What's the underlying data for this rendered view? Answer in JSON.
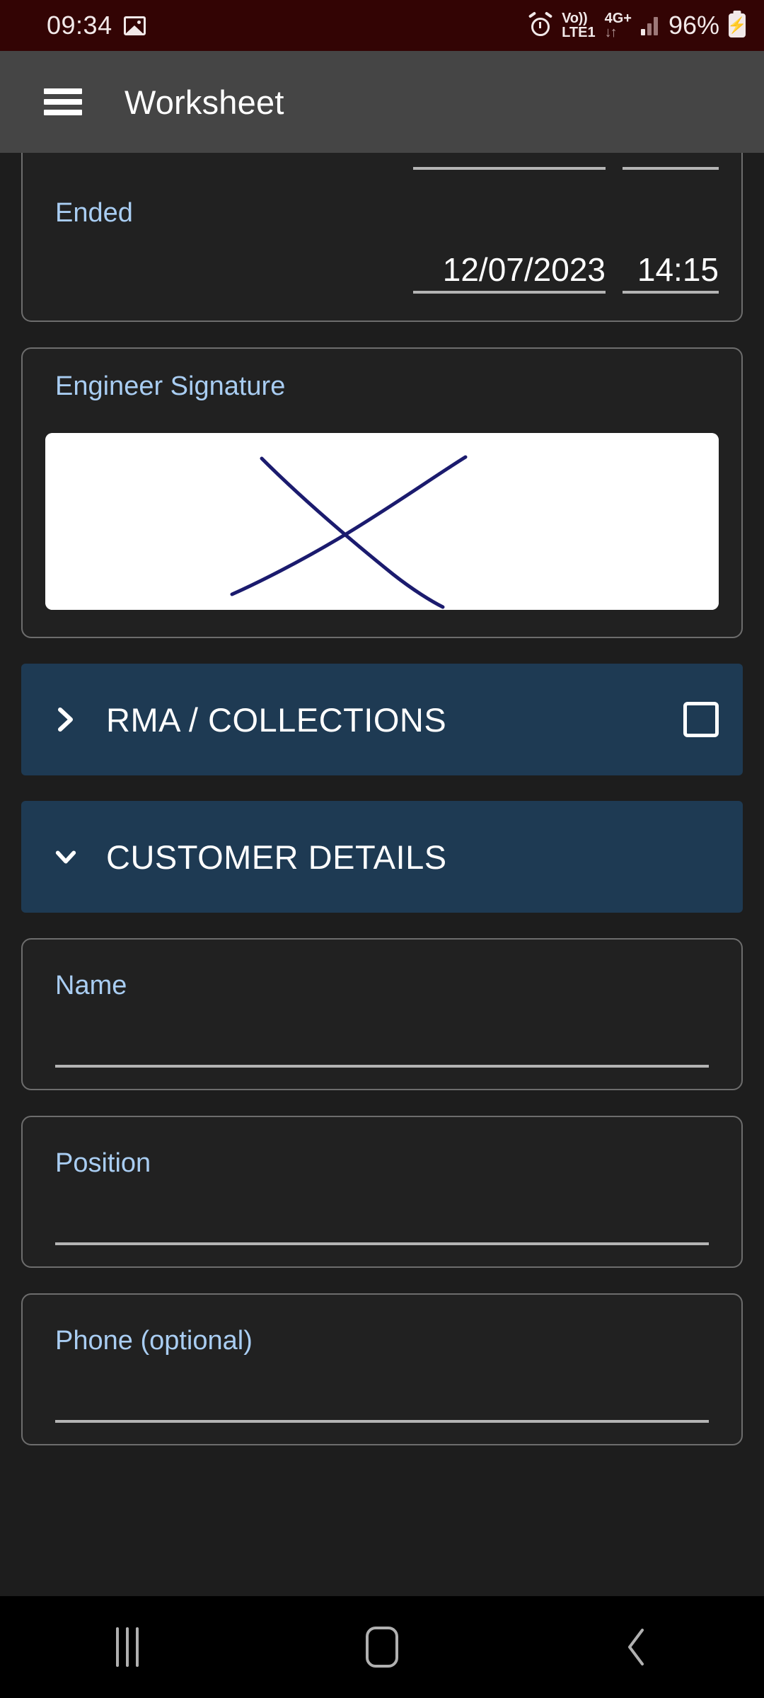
{
  "status_bar": {
    "clock": "09:34",
    "image_icon": "image-icon",
    "alarm_icon": "alarm-icon",
    "volte_line1": "Vo))",
    "volte_line2": "LTE1",
    "network_type": "4G+",
    "data_arrows": "↓↑",
    "signal_icon": "signal-bars-icon",
    "battery_percent": "96%",
    "battery_icon": "battery-charging-icon"
  },
  "app_bar": {
    "menu_icon": "hamburger-menu-icon",
    "title": "Worksheet"
  },
  "content": {
    "ended_card": {
      "label": "Ended",
      "date_value": "12/07/2023",
      "time_value": "14:15"
    },
    "signature_card": {
      "label": "Engineer Signature",
      "signature_color": "#1b1b6e",
      "pad_background": "#ffffff"
    },
    "sections": [
      {
        "title": "RMA / COLLECTIONS",
        "expanded": false,
        "chevron": "chevron-right-icon",
        "has_checkbox": true,
        "checked": false
      },
      {
        "title": "CUSTOMER DETAILS",
        "expanded": true,
        "chevron": "chevron-down-icon",
        "has_checkbox": false,
        "checked": false
      }
    ],
    "customer_fields": [
      {
        "label": "Name",
        "value": ""
      },
      {
        "label": "Position",
        "value": ""
      },
      {
        "label": "Phone (optional)",
        "value": ""
      }
    ]
  },
  "nav_bar": {
    "recents_icon": "recents-icon",
    "home_icon": "home-icon",
    "back_icon": "back-icon"
  },
  "colors": {
    "status_bar_bg": "#330404",
    "app_bar_bg": "#454545",
    "page_bg": "#1d1d1d",
    "card_bg": "#212121",
    "card_border": "#6d6d6d",
    "section_header_bg": "#1e3a53",
    "label_blue": "#a9cdf2",
    "underline": "#b4b4b4"
  }
}
